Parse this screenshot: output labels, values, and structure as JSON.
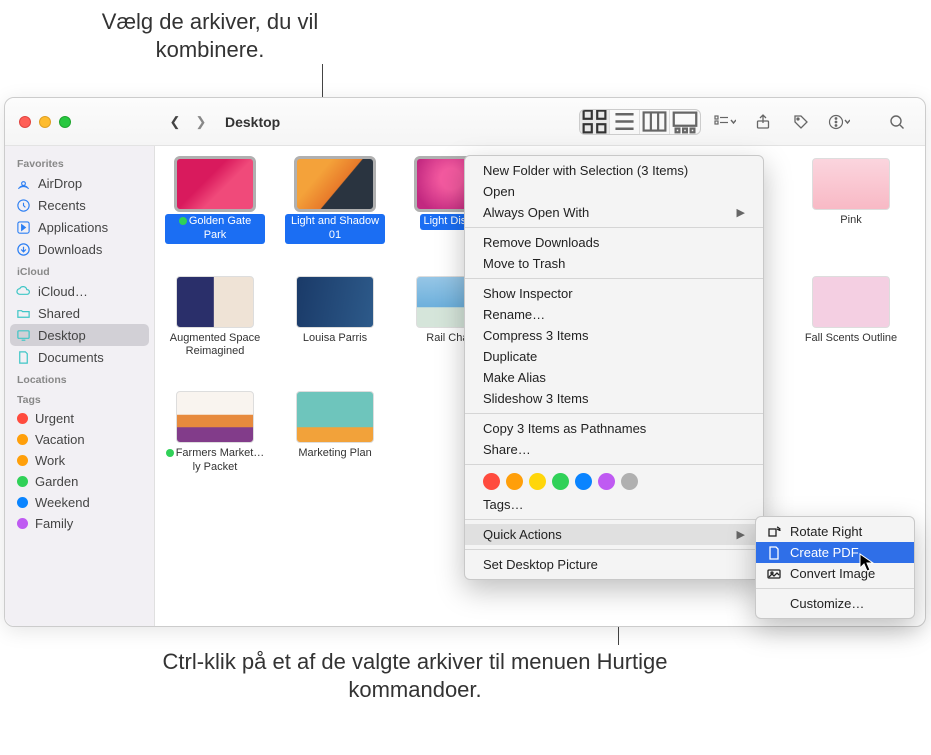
{
  "callouts": {
    "top": "Vælg de arkiver, du vil kombinere.",
    "bottom": "Ctrl-klik på et af de valgte arkiver til menuen Hurtige kommandoer."
  },
  "window": {
    "title": "Desktop"
  },
  "sidebar": {
    "sections": [
      {
        "header": "Favorites",
        "items": [
          {
            "label": "AirDrop",
            "icon": "airdrop"
          },
          {
            "label": "Recents",
            "icon": "clock"
          },
          {
            "label": "Applications",
            "icon": "apps"
          },
          {
            "label": "Downloads",
            "icon": "download"
          }
        ]
      },
      {
        "header": "iCloud",
        "items": [
          {
            "label": "iCloud…",
            "icon": "cloud"
          },
          {
            "label": "Shared",
            "icon": "folder"
          },
          {
            "label": "Desktop",
            "icon": "desktop",
            "active": true
          },
          {
            "label": "Documents",
            "icon": "doc"
          }
        ]
      },
      {
        "header": "Locations",
        "items": []
      },
      {
        "header": "Tags",
        "items": [
          {
            "label": "Urgent",
            "color": "#ff4b3e"
          },
          {
            "label": "Vacation",
            "color": "#ff9f0a"
          },
          {
            "label": "Work",
            "color": "#ff9f0a"
          },
          {
            "label": "Garden",
            "color": "#30d158"
          },
          {
            "label": "Weekend",
            "color": "#0a84ff"
          },
          {
            "label": "Family",
            "color": "#bf5af2"
          }
        ]
      }
    ]
  },
  "files": [
    {
      "label": "Golden Gate Park",
      "selected": true,
      "tag_color": "#30d158",
      "thumb": "t-flower"
    },
    {
      "label": "Light and Shadow 01",
      "selected": true,
      "thumb": "t-orange"
    },
    {
      "label": "Light Display",
      "selected": true,
      "thumb": "t-magenta"
    },
    {
      "label": "Pink",
      "selected": false,
      "thumb": "t-pink"
    },
    {
      "label": "Augmented Space Reimagined",
      "selected": false,
      "thumb": "t-aug",
      "special": "keynote"
    },
    {
      "label": "Louisa Parris",
      "selected": false,
      "thumb": "t-louisa"
    },
    {
      "label": "Rail Chaser",
      "selected": false,
      "thumb": "t-rail"
    },
    {
      "label": "Fall Scents Outline",
      "selected": false,
      "thumb": "t-scent"
    },
    {
      "label": "Farmers Market…ly Packet",
      "selected": false,
      "tag_color": "#30d158",
      "thumb": "t-farm"
    },
    {
      "label": "Marketing Plan",
      "selected": false,
      "thumb": "t-mkt"
    }
  ],
  "context_menu": {
    "groups": [
      [
        {
          "label": "New Folder with Selection (3 Items)"
        },
        {
          "label": "Open"
        },
        {
          "label": "Always Open With",
          "submenu": true
        }
      ],
      [
        {
          "label": "Remove Downloads"
        },
        {
          "label": "Move to Trash"
        }
      ],
      [
        {
          "label": "Show Inspector"
        },
        {
          "label": "Rename…"
        },
        {
          "label": "Compress 3 Items"
        },
        {
          "label": "Duplicate"
        },
        {
          "label": "Make Alias"
        },
        {
          "label": "Slideshow 3 Items"
        }
      ],
      [
        {
          "label": "Copy 3 Items as Pathnames"
        },
        {
          "label": "Share…"
        }
      ]
    ],
    "tag_colors": [
      "#ff4b3e",
      "#ff9f0a",
      "#ffd60a",
      "#30d158",
      "#0a84ff",
      "#bf5af2",
      "#b0b0b0"
    ],
    "tags_label": "Tags…",
    "quick_actions_label": "Quick Actions",
    "set_desktop_label": "Set Desktop Picture"
  },
  "submenu": {
    "items": [
      {
        "label": "Rotate Right",
        "icon": "rotate"
      },
      {
        "label": "Create PDF",
        "icon": "pdf",
        "selected": true
      },
      {
        "label": "Convert Image",
        "icon": "convert"
      }
    ],
    "customize_label": "Customize…"
  }
}
